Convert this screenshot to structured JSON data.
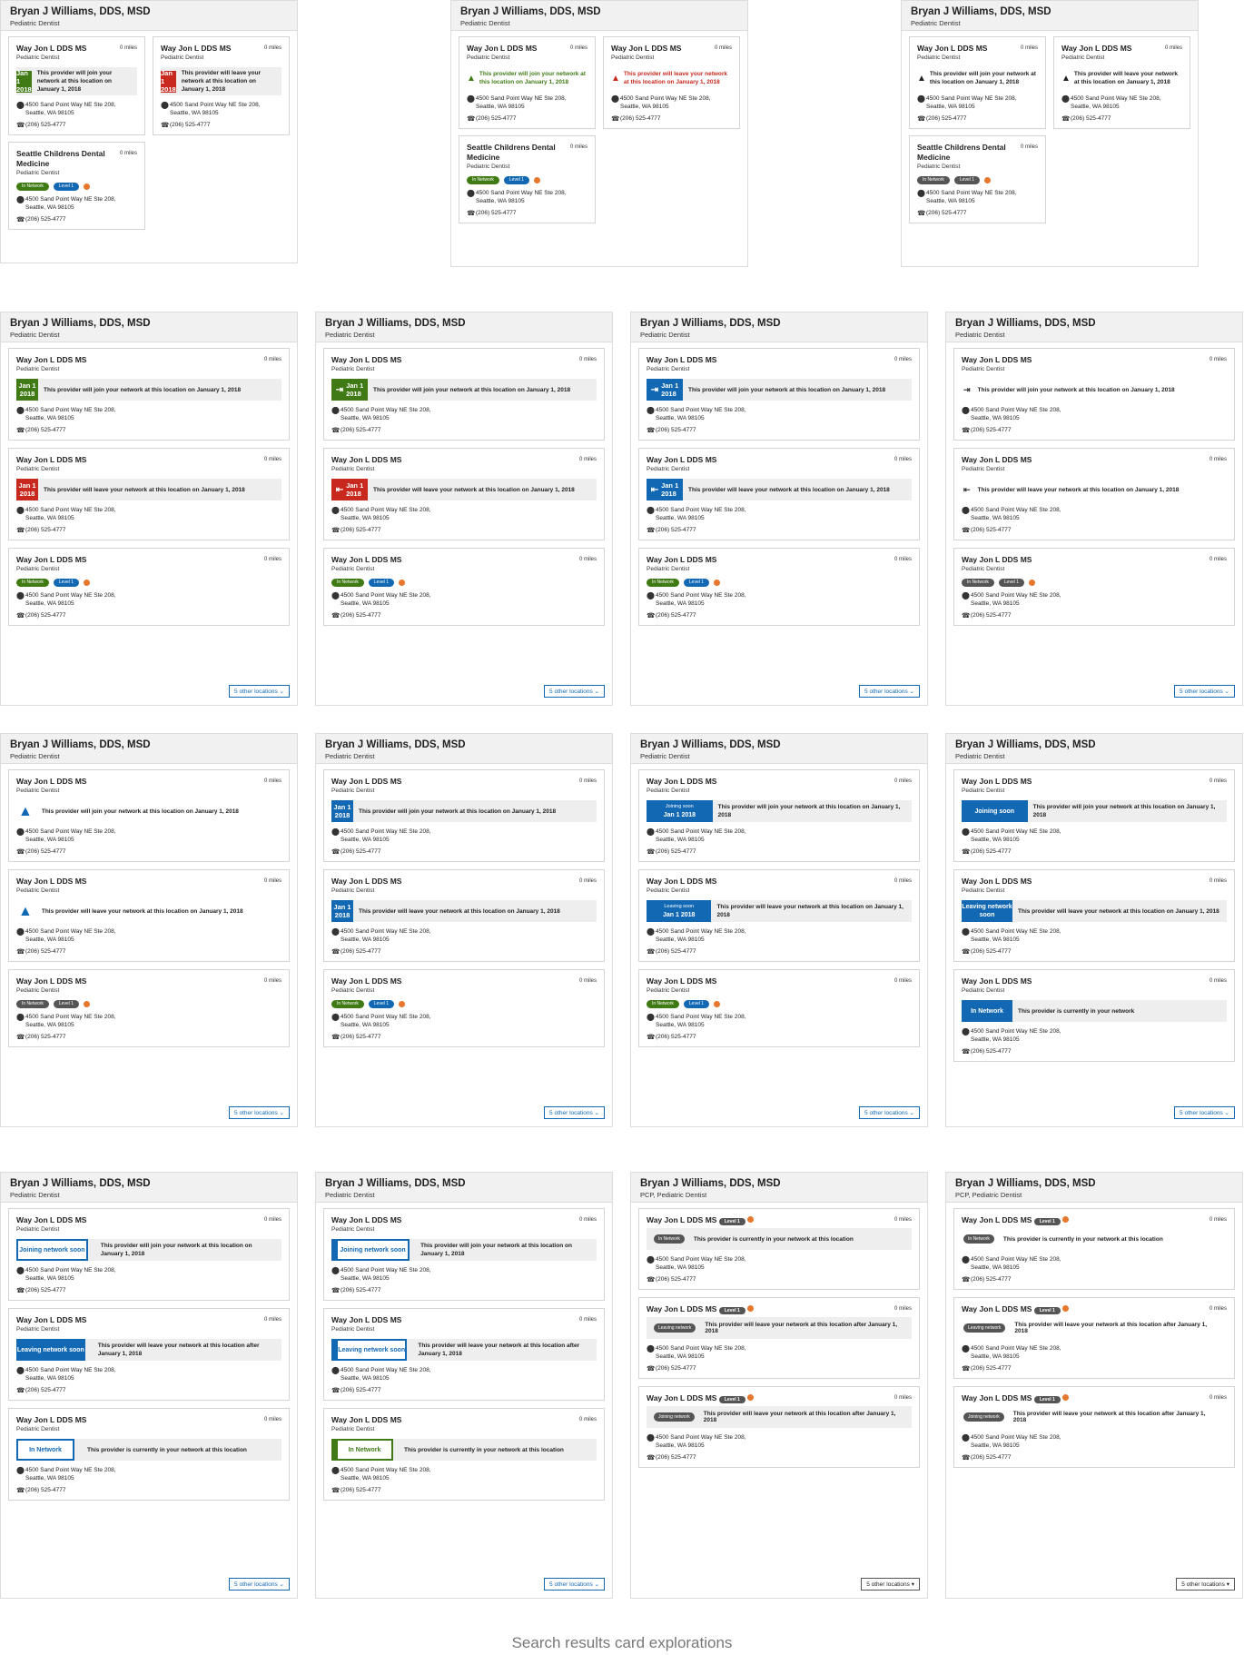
{
  "caption": "Search results card explorations",
  "provider": {
    "name": "Bryan J Williams, DDS, MSD",
    "spec": "Pediatric Dentist",
    "spec_pcp": "PCP, Pediatric Dentist"
  },
  "card": {
    "name": "Way Jon L DDS MS",
    "alt_name": "Seattle Childrens Dental Medicine",
    "spec": "Pediatric Dentist",
    "miles": "0 miles",
    "addr1": "4500 Sand Point Way NE Ste 208,",
    "addr2": "Seattle, WA 98105",
    "phone": "(206) 525-4777"
  },
  "date": {
    "month": "Jan 1",
    "year": "2018",
    "full": "Jan 1 2018"
  },
  "msg": {
    "join_at": "This provider will join your network at this location on January 1, 2018",
    "leave_at": "This provider will leave your network at this location on January 1, 2018",
    "leave_after": "This provider will leave your network at this location after January 1, 2018",
    "current_loc": "This provider is currently in your network at this location",
    "current": "This provider is currently in your network"
  },
  "labels": {
    "in_network": "In Network",
    "level1": "Level 1",
    "joining_soon": "Joining soon",
    "leaving_soon": "Leaving soon",
    "leaving_network_soon": "Leaving network soon",
    "joining_network_soon": "Joining network soon",
    "leaving_network": "Leaving network",
    "joining_network": "Joining network",
    "more": "5 other locations",
    "more_arrow": "5 other locations"
  },
  "colors": {
    "green": "#3f7a14",
    "red": "#c8281e",
    "blue": "#1268b3",
    "orange": "#e8772e"
  },
  "icons": [
    "map-pin-icon",
    "phone-icon",
    "warning-icon",
    "enter-icon",
    "exit-icon",
    "check-icon",
    "chevron-down-icon",
    "caret-down-icon"
  ]
}
